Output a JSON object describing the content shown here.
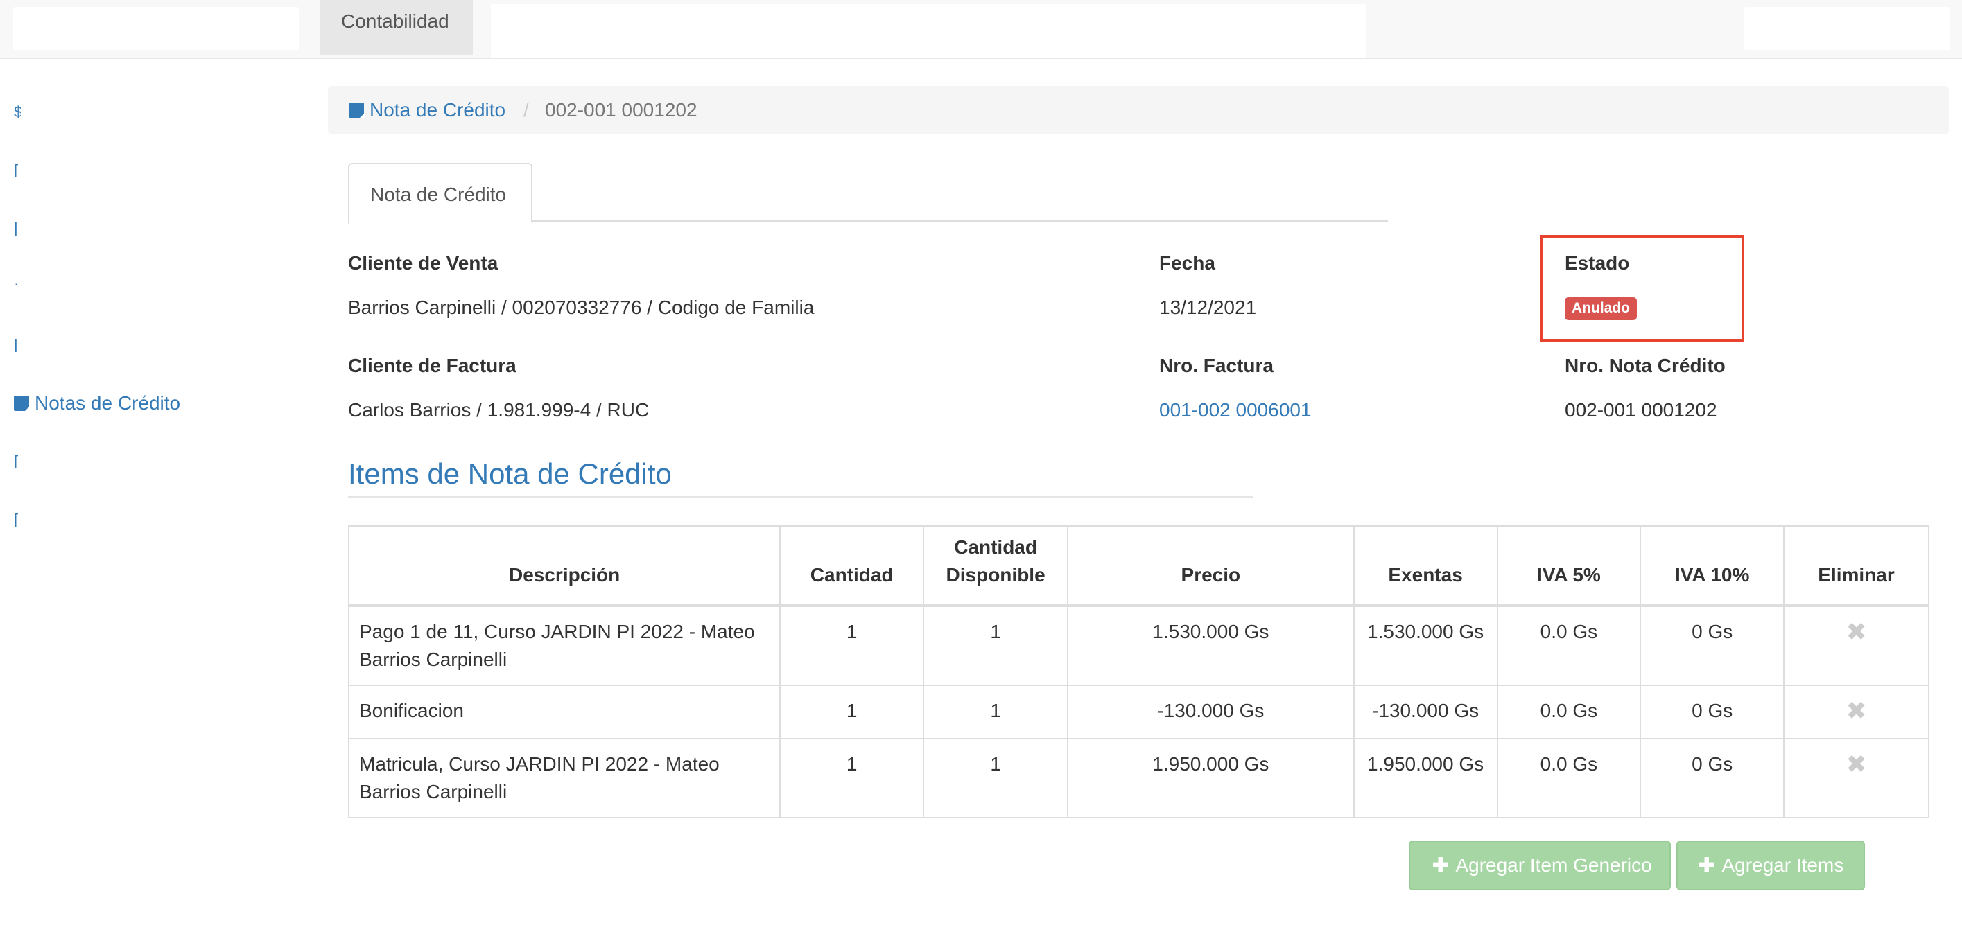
{
  "topnav": {
    "tab_label": "Contabilidad"
  },
  "sidebar": {
    "notas_label": "Notas de Crédito"
  },
  "breadcrumb": {
    "link_label": "Nota de Crédito",
    "separator": "/",
    "current": "002-001 0001202"
  },
  "tabs": {
    "active_label": "Nota de Crédito"
  },
  "details": {
    "cliente_venta_label": "Cliente de Venta",
    "cliente_venta_value": "Barrios Carpinelli / 002070332776 / Codigo de Familia",
    "fecha_label": "Fecha",
    "fecha_value": "13/12/2021",
    "estado_label": "Estado",
    "estado_value": "Anulado",
    "cliente_factura_label": "Cliente de Factura",
    "cliente_factura_value": "Carlos Barrios / 1.981.999-4 / RUC",
    "nro_factura_label": "Nro. Factura",
    "nro_factura_value": "001-002 0006001",
    "nro_nota_label": "Nro. Nota Crédito",
    "nro_nota_value": "002-001 0001202"
  },
  "items_section": {
    "title": "Items de Nota de Crédito",
    "headers": [
      "Descripción",
      "Cantidad",
      "Cantidad Disponible",
      "Precio",
      "Exentas",
      "IVA 5%",
      "IVA 10%",
      "Eliminar"
    ],
    "rows": [
      {
        "descripcion": "Pago 1 de 11, Curso JARDIN PI 2022 - Mateo Barrios Carpinelli",
        "cantidad": "1",
        "disponible": "1",
        "precio": "1.530.000 Gs",
        "exentas": "1.530.000 Gs",
        "iva5": "0.0 Gs",
        "iva10": "0 Gs"
      },
      {
        "descripcion": "Bonificacion",
        "cantidad": "1",
        "disponible": "1",
        "precio": "-130.000 Gs",
        "exentas": "-130.000 Gs",
        "iva5": "0.0 Gs",
        "iva10": "0 Gs"
      },
      {
        "descripcion": "Matricula, Curso JARDIN PI 2022 - Mateo Barrios Carpinelli",
        "cantidad": "1",
        "disponible": "1",
        "precio": "1.950.000 Gs",
        "exentas": "1.950.000 Gs",
        "iva5": "0.0 Gs",
        "iva10": "0 Gs"
      }
    ]
  },
  "buttons": {
    "add_generic": "Agregar Item Generico",
    "add_items": "Agregar Items"
  },
  "colors": {
    "link": "#337ab7",
    "danger": "#d9534f",
    "success_disabled": "#a7d6a5",
    "highlight": "#e8432e"
  }
}
